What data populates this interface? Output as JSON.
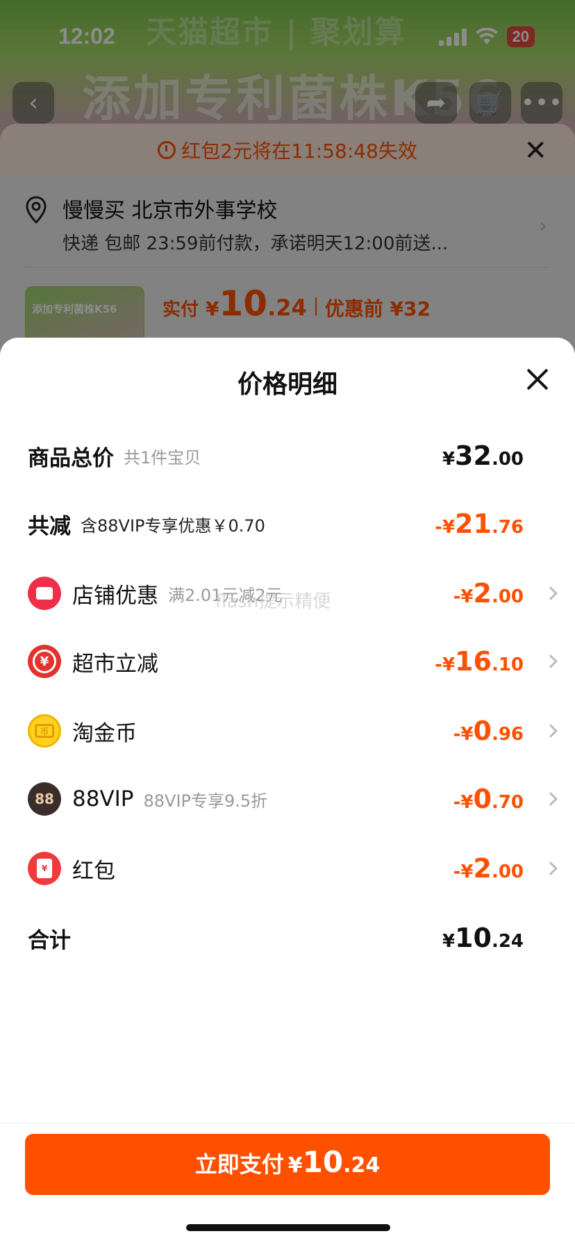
{
  "status_bar": {
    "time": "12:02",
    "battery": "20"
  },
  "banner": {
    "brand": "天猫超市 | 聚划算",
    "title": "添加专利菌株K56"
  },
  "order_sheet": {
    "warning": "红包2元将在11:58:48失效",
    "address_line1": "慢慢买 北京市外事学校",
    "address_line2": "快递 包邮 23:59前付款，承诺明天12:00前送...",
    "thumb_text": "添加专利菌株K56",
    "price_label": "实付",
    "price_currency": "¥",
    "price_int": "10",
    "price_dec": ".24",
    "before_label": "优惠前 ¥32"
  },
  "modal": {
    "title": "价格明细",
    "rows": {
      "total": {
        "label": "商品总价",
        "sub": "共1件宝贝",
        "cur": "¥",
        "int": "32",
        "dec": ".00"
      },
      "reduce": {
        "label": "共减",
        "sub": "含88VIP专享优惠￥0.70",
        "cur": "-¥",
        "int": "21",
        "dec": ".76"
      },
      "shop": {
        "label": "店铺优惠",
        "sub": "满2.01元减2元",
        "cur": "-¥",
        "int": "2",
        "dec": ".00"
      },
      "market": {
        "label": "超市立减",
        "cur": "-¥",
        "int": "16",
        "dec": ".10"
      },
      "coin": {
        "label": "淘金币",
        "cur": "-¥",
        "int": "0",
        "dec": ".96"
      },
      "vip": {
        "label": "88VIP",
        "sub": "88VIP专享9.5折",
        "icon_text": "88",
        "cur": "-¥",
        "int": "0",
        "dec": ".70"
      },
      "redpack": {
        "label": "红包",
        "cur": "-¥",
        "int": "2",
        "dec": ".00"
      },
      "sum": {
        "label": "合计",
        "cur": "¥",
        "int": "10",
        "dec": ".24"
      }
    },
    "watermark": "flash提示精便"
  },
  "pay_button": {
    "label": "立即支付",
    "cur": "¥",
    "int": "10",
    "dec": ".24"
  },
  "colors": {
    "accent": "#ff5000",
    "text": "#111111",
    "muted": "#999999"
  }
}
